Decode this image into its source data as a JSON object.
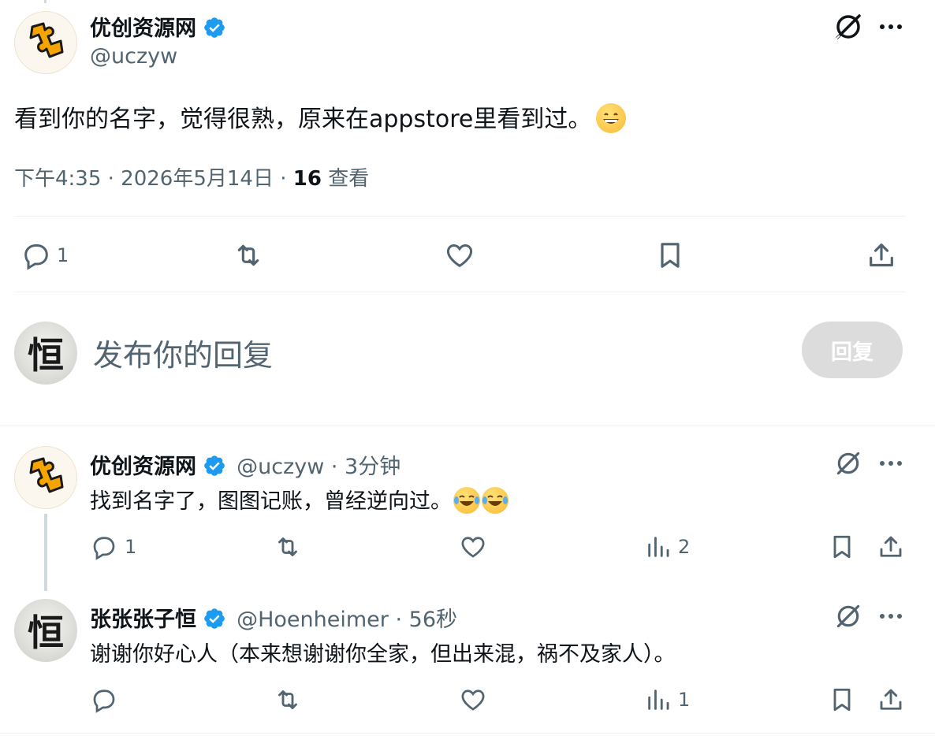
{
  "main_post": {
    "author_name": "优创资源网",
    "author_handle": "@uczyw",
    "text": "看到你的名字，觉得很熟，原来在appstore里看到过。",
    "emoji": "grinning-face",
    "time": "下午4:35 · 2026年5月14日 · ",
    "views_count": "16",
    "views_label": " 查看",
    "actions": {
      "reply_count": "1"
    }
  },
  "composer": {
    "placeholder": "发布你的回复",
    "button_label": "回复",
    "avatar_char": "恒"
  },
  "replies": [
    {
      "author_name": "优创资源网",
      "author_handle": "@uczyw",
      "time": "3分钟",
      "text": "找到名字了，图图记账，曾经逆向过。",
      "emoji": "face-with-tears-of-joy",
      "reply_count": "1",
      "views_count": "2"
    },
    {
      "author_name": "张张张子恒",
      "author_handle": "@Hoenheimer",
      "time": "56秒",
      "text": "谢谢你好心人（本来想谢谢你全家，但出来混，祸不及家人）。",
      "avatar_char": "恒",
      "views_count": "1"
    }
  ],
  "sep": " · ",
  "colors": {
    "verified": "#1d9bf0",
    "muted": "#536471",
    "divider": "#eff3f4"
  }
}
